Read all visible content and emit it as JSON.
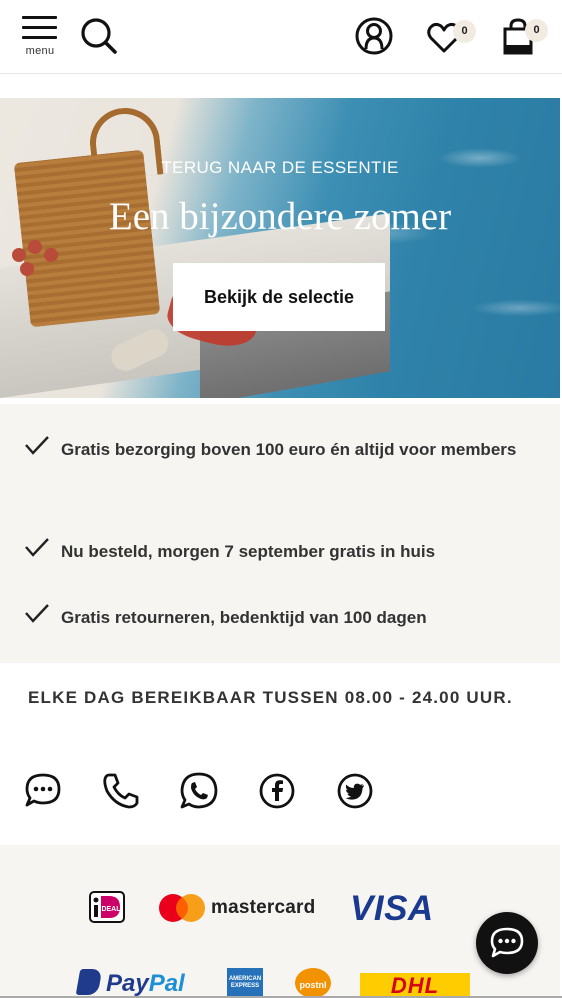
{
  "header": {
    "menu_label": "menu",
    "wishlist_count": "0",
    "cart_count": "0"
  },
  "hero": {
    "kicker": "TERUG NAAR DE ESSENTIE",
    "title": "Een bijzondere zomer",
    "cta_label": "Bekijk de selectie"
  },
  "usps": {
    "items": [
      "Gratis bezorging boven 100 euro én altijd voor members",
      "Nu besteld, morgen 7 september gratis in huis",
      "Gratis retourneren, bedenktijd van 100 dagen"
    ]
  },
  "contact": {
    "title": "ELKE DAG BEREIKBAAR TUSSEN 08.00 - 24.00 UUR.",
    "channels": [
      "chat-icon",
      "phone-icon",
      "whatsapp-icon",
      "facebook-icon",
      "twitter-icon"
    ]
  },
  "payments": {
    "mastercard_label": "mastercard",
    "visa_label": "VISA",
    "paypal_label_a": "Pay",
    "paypal_label_b": "Pal",
    "dhl_label": "DHL",
    "ideal_label": "iDEAL",
    "amex_label": "AMERICAN EXPRESS",
    "postnl_label": "postnl"
  },
  "colors": {
    "usp_background": "#f6f5f2",
    "visa_blue": "#1a3a8f",
    "mastercard_red": "#eb001b",
    "mastercard_orange": "#f79e1b",
    "dhl_yellow": "#ffcc00",
    "dhl_red": "#d40511",
    "badge_bg": "#f1ebe2"
  }
}
